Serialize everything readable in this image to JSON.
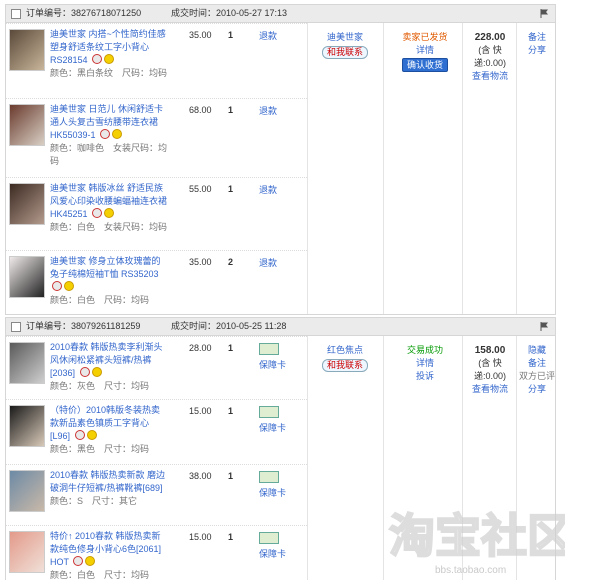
{
  "orders": [
    {
      "order_label": "订单编号：38276718071250",
      "deal_time": "成交时间：2010-05-27 17:13",
      "items": [
        {
          "title": "迪美世家 内搭~个性简约佳感塑身舒适条纹工字小背心 RS28154",
          "attrs": "颜色：黑白条纹　尺码：均码",
          "price": "35.00",
          "qty": "1",
          "action": "退款",
          "thumb": [
            "#5b4a3a",
            "#c8b59a"
          ]
        },
        {
          "title": "迪美世家 日范儿 休闲舒适卡通人头复古雪纺腰带连衣裙 HK55039-1",
          "attrs": "颜色：咖啡色　女装尺码：均码",
          "price": "68.00",
          "qty": "1",
          "action": "退款",
          "thumb": [
            "#6a3b2e",
            "#d9cfc4"
          ]
        },
        {
          "title": "迪美世家 韩版冰丝 舒适民族风爱心印染收腰蝙蝠袖连衣裙 HK45251",
          "attrs": "颜色：白色　女装尺码：均码",
          "price": "55.00",
          "qty": "1",
          "action": "退款",
          "thumb": [
            "#3c2a22",
            "#b39a8c"
          ]
        },
        {
          "title": "迪美世家 修身立体玫瑰蕾的兔子纯棉短袖T恤 RS35203",
          "attrs": "颜色：白色　尺码：均码",
          "price": "35.00",
          "qty": "2",
          "action": "退款",
          "thumb": [
            "#f0eaea",
            "#222"
          ]
        }
      ],
      "seller": {
        "name": "迪美世家",
        "contact": "和我联系"
      },
      "status": {
        "text": "卖家已发货",
        "detail": "详情",
        "button": "确认收货"
      },
      "total": {
        "amount": "228.00",
        "shipping": "(含 快递:0.00)",
        "view": "查看物流"
      },
      "ops": [
        "备注",
        "分享"
      ]
    },
    {
      "order_label": "订单编号：38079261181259",
      "deal_time": "成交时间：2010-05-25 11:28",
      "items": [
        {
          "title": "2010春款 韩版热卖李利渐头风休闲松紧裤头短裤/热裤[2036]",
          "attrs": "颜色：灰色　尺寸：均码",
          "price": "28.00",
          "qty": "1",
          "action": "保障卡",
          "thumb": [
            "#5a5a5a",
            "#cfcfcf"
          ]
        },
        {
          "title": "（特价）2010韩版冬装热卖款新品素色镇质工字背心[L96]",
          "attrs": "颜色：黑色　尺寸：均码",
          "price": "15.00",
          "qty": "1",
          "action": "保障卡",
          "thumb": [
            "#1a1a1a",
            "#d8c9b8"
          ]
        },
        {
          "title": "2010春款 韩版热卖新款 磨边破洞牛仔短裤/热裤靴裤[689]",
          "attrs": "颜色：S　尺寸：其它",
          "price": "38.00",
          "qty": "1",
          "action": "保障卡",
          "thumb": [
            "#6d8aa6",
            "#c9b9a8"
          ]
        },
        {
          "title": "特价↑ 2010春款 韩版热卖新款纯色修身小背心6色[2061] HOT",
          "attrs": "颜色：白色　尺寸：均码",
          "price": "15.00",
          "qty": "1",
          "action": "保障卡",
          "thumb": [
            "#e39a8a",
            "#f0e0d8"
          ]
        }
      ],
      "seller": {
        "name": "红色焦点",
        "contact": "和我联系"
      },
      "status": {
        "text": "交易成功",
        "detail": "详情",
        "extra": "投诉"
      },
      "total": {
        "amount": "158.00",
        "shipping": "(含 快递:0.00)",
        "view": "查看物流"
      },
      "ops": [
        "隐藏",
        "备注",
        "双方已评",
        "分享"
      ]
    }
  ],
  "watermark": {
    "text": "bbs.taobao.com",
    "logo": "淘宝社区"
  },
  "colors": {
    "link": "#3366cc",
    "header_bg": "#ebebeb",
    "status_shipped": "#e05a00",
    "status_done": "#009900"
  }
}
